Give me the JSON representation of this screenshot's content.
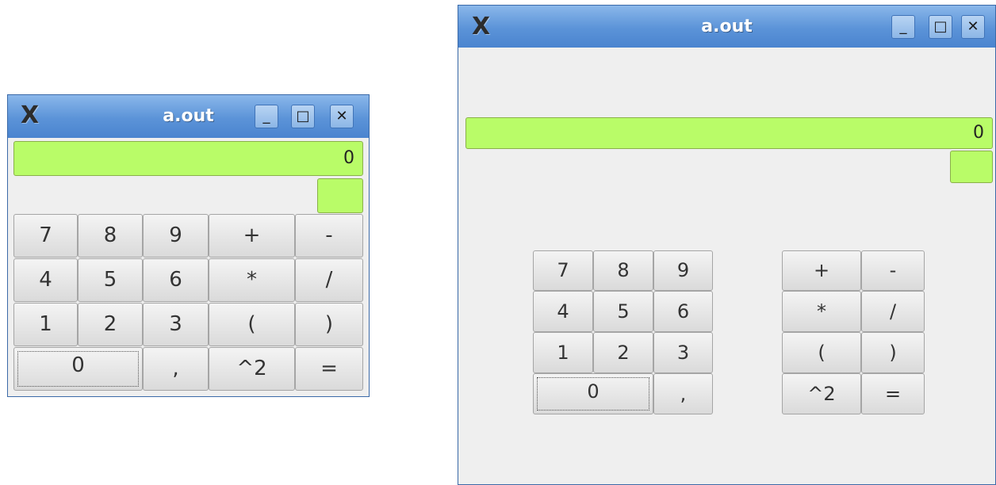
{
  "windows": [
    {
      "title": "a.out",
      "display_value": "0",
      "buttons": {
        "b7": "7",
        "b8": "8",
        "b9": "9",
        "plus": "+",
        "minus": "-",
        "b4": "4",
        "b5": "5",
        "b6": "6",
        "mul": "*",
        "div": "/",
        "b1": "1",
        "b2": "2",
        "b3": "3",
        "lparen": "(",
        "rparen": ")",
        "b0": "0",
        "comma": ",",
        "square": "^2",
        "equals": "="
      }
    },
    {
      "title": "a.out",
      "display_value": "0",
      "buttons": {
        "b7": "7",
        "b8": "8",
        "b9": "9",
        "plus": "+",
        "minus": "-",
        "b4": "4",
        "b5": "5",
        "b6": "6",
        "mul": "*",
        "div": "/",
        "b1": "1",
        "b2": "2",
        "b3": "3",
        "lparen": "(",
        "rparen": ")",
        "b0": "0",
        "comma": ",",
        "square": "^2",
        "equals": "="
      }
    }
  ],
  "window_controls": {
    "minimize": "_",
    "maximize": "□",
    "close": "✕"
  },
  "icons": {
    "app_logo": "x-logo-icon"
  },
  "colors": {
    "display_green": "#b9fc68",
    "titlebar_blue": "#5b93d8"
  }
}
